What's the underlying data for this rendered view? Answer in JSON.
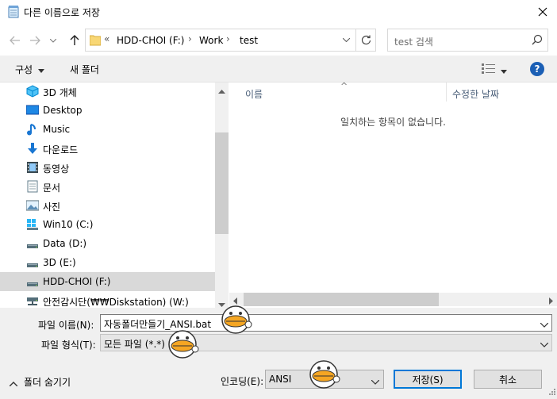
{
  "window": {
    "title": "다른 이름으로 저장"
  },
  "address": {
    "overflow": "«",
    "crumbs": [
      "HDD-CHOI (F:)",
      "Work",
      "test"
    ]
  },
  "search": {
    "placeholder": "test 검색"
  },
  "toolbar": {
    "organize": "구성",
    "new_folder": "새 폴더",
    "help": "?"
  },
  "nav": {
    "items": [
      {
        "label": "3D 개체",
        "icon": "3d-objects-icon"
      },
      {
        "label": "Desktop",
        "icon": "desktop-icon"
      },
      {
        "label": "Music",
        "icon": "music-icon"
      },
      {
        "label": "다운로드",
        "icon": "download-icon"
      },
      {
        "label": "동영상",
        "icon": "video-icon"
      },
      {
        "label": "문서",
        "icon": "document-icon"
      },
      {
        "label": "사진",
        "icon": "picture-icon"
      },
      {
        "label": "Win10 (C:)",
        "icon": "windows-drive-icon"
      },
      {
        "label": "Data (D:)",
        "icon": "drive-icon"
      },
      {
        "label": "3D (E:)",
        "icon": "drive-icon"
      },
      {
        "label": "HDD-CHOI (F:)",
        "icon": "drive-icon",
        "selected": true
      },
      {
        "label": "안전감시단(₩₩Diskstation) (W:)",
        "icon": "network-drive-icon"
      }
    ]
  },
  "files": {
    "col_name": "이름",
    "col_date": "수정한 날짜",
    "empty_message": "일치하는 항목이 없습니다."
  },
  "form": {
    "filename_label": "파일 이름(N):",
    "filename_value": "자동폴더만들기_ANSI.bat",
    "filetype_label": "파일 형식(T):",
    "filetype_value": "모든 파일 (*.*)",
    "encoding_label": "인코딩(E):",
    "encoding_value": "ANSI",
    "save_label": "저장(S)",
    "cancel_label": "취소",
    "hide_folders_label": "폴더 숨기기"
  },
  "colors": {
    "accent": "#0078d7",
    "selected_bg": "#d9d9d9",
    "pane_bg": "#f0f0f0",
    "help_blue": "#1b5fb5"
  }
}
